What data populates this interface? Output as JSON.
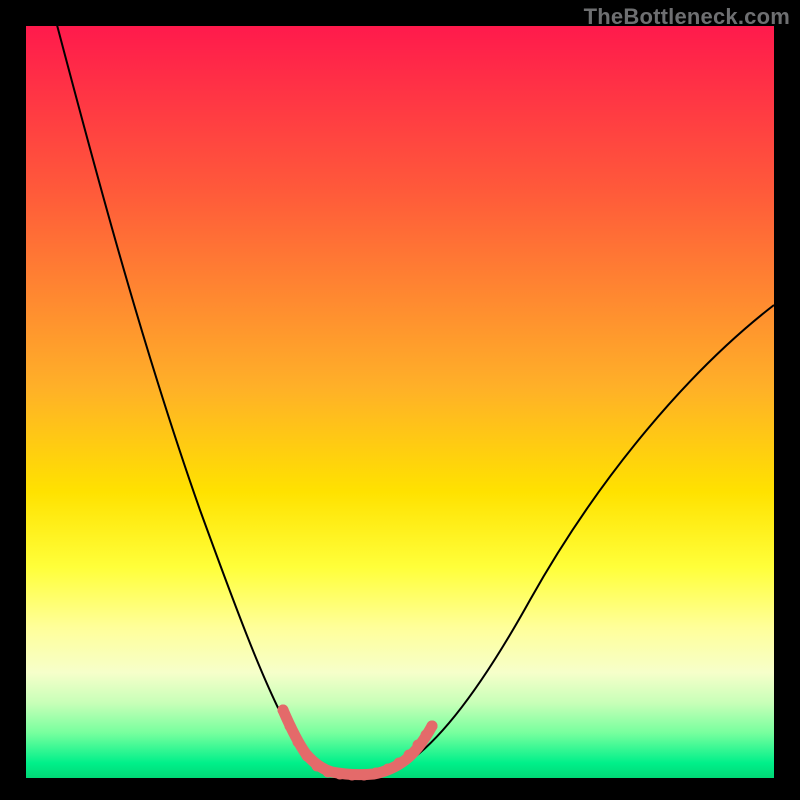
{
  "watermark": "TheBottleneck.com",
  "chart_data": {
    "type": "line",
    "title": "",
    "xlabel": "",
    "ylabel": "",
    "xlim": [
      0,
      100
    ],
    "ylim": [
      0,
      100
    ],
    "grid": false,
    "legend": false,
    "background_gradient": {
      "top": "#ff1a4c",
      "mid": "#ffe200",
      "bottom": "#00d876",
      "description": "vertical red-to-green gradient indicating bottleneck severity (red high, green low)"
    },
    "series": [
      {
        "name": "bottleneck-curve",
        "color": "#000000",
        "x": [
          4,
          8,
          12,
          16,
          20,
          24,
          28,
          31,
          34,
          36,
          38,
          40,
          42,
          44,
          46,
          50,
          54,
          58,
          62,
          66,
          70,
          76,
          82,
          88,
          94,
          100
        ],
        "y": [
          100,
          88,
          76,
          65,
          55,
          45,
          35,
          26,
          18,
          12,
          7,
          3.5,
          1.5,
          1,
          1,
          1.3,
          3,
          6,
          10,
          15,
          21,
          30,
          40,
          49,
          58,
          66
        ]
      },
      {
        "name": "minimum-highlight",
        "color": "#e46a6a",
        "x": [
          34.5,
          35.5,
          36.5,
          37.5,
          38.5,
          39.5,
          40.5,
          41.5,
          42.5,
          43.5,
          44.5,
          45.5,
          46.5,
          47.5,
          48.5,
          49.5,
          50.5,
          51.5,
          52.5
        ],
        "y": [
          14,
          11,
          8.5,
          6.2,
          4.2,
          2.8,
          1.9,
          1.3,
          1.0,
          1.0,
          1.0,
          1.1,
          1.4,
          1.9,
          2.6,
          3.5,
          4.6,
          5.9,
          7.4
        ]
      }
    ],
    "minimum": {
      "x_range": [
        40,
        48
      ],
      "y": 1.0
    }
  }
}
